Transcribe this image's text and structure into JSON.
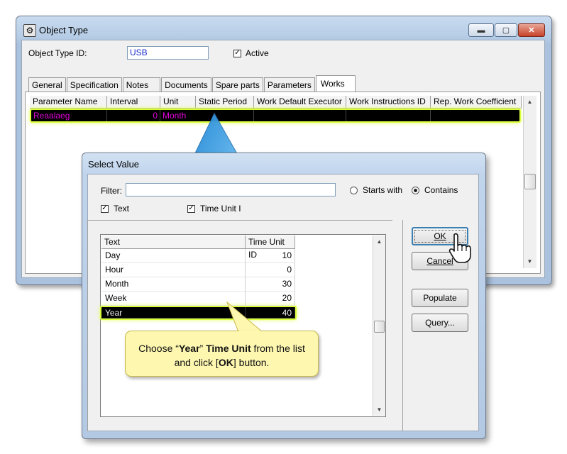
{
  "main_window": {
    "title": "Object Type",
    "object_type_id_label": "Object Type ID:",
    "object_type_id_value": "USB",
    "active_label": "Active",
    "active_checked": true,
    "tabs": [
      "General",
      "Specification",
      "Notes",
      "Documents",
      "Spare parts",
      "Parameters",
      "Works"
    ],
    "active_tab": "Works",
    "grid": {
      "columns": [
        "Parameter Name",
        "Interval",
        "Unit",
        "Static Period",
        "Work Default Executor",
        "Work Instructions ID",
        "Rep. Work Coefficient"
      ],
      "rows": [
        {
          "parameter_name": "Reaalaeg",
          "interval": "0",
          "unit": "Month"
        }
      ]
    }
  },
  "dialog": {
    "title": "Select Value",
    "filter_label": "Filter:",
    "filter_value": "",
    "starts_with_label": "Starts with",
    "contains_label": "Contains",
    "match_mode": "Contains",
    "text_checkbox_label": "Text",
    "time_unit_checkbox_label": "Time Unit I",
    "list": {
      "columns": [
        "Text",
        "Time Unit ID"
      ],
      "rows": [
        {
          "text": "Day",
          "id": "10"
        },
        {
          "text": "Hour",
          "id": "0"
        },
        {
          "text": "Month",
          "id": "30"
        },
        {
          "text": "Week",
          "id": "20"
        },
        {
          "text": "Year",
          "id": "40"
        }
      ],
      "selected": "Year"
    },
    "buttons": {
      "ok": "OK",
      "cancel": "Cancel",
      "populate": "Populate",
      "query": "Query..."
    }
  },
  "callout": {
    "part1": "Choose “",
    "bold1": "Year",
    "part2": "” ",
    "bold2": "Time Unit",
    "part3": " from the list and click [",
    "bold3": "OK",
    "part4": "] button."
  },
  "icons": {
    "minimize": "minimize-icon",
    "maximize": "maximize-icon",
    "close": "close-icon",
    "app": "object-type-app-icon",
    "pointer": "hand-pointer-icon",
    "arrow": "curved-arrow-icon"
  },
  "colors": {
    "highlight_border": "#d8ff3a",
    "selected_row_bg": "#000000",
    "grid_row_text": "#e000d8",
    "callout_bg": "#fdf7b0",
    "arrow_blue": "#3aa9e8"
  }
}
